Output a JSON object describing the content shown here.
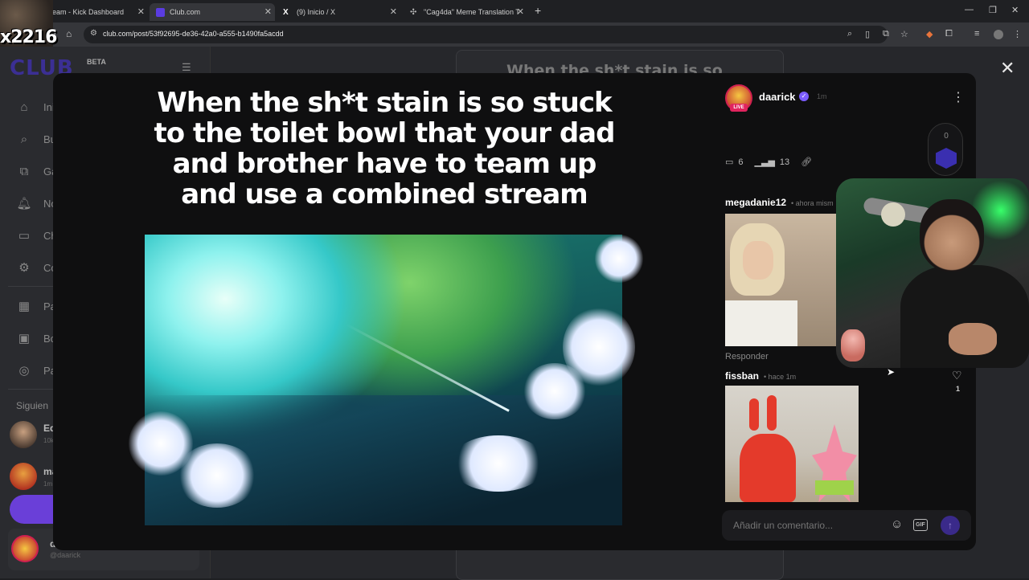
{
  "browser": {
    "tabs": [
      {
        "label": "ream - Kick Dashboard",
        "active": false,
        "favicon_color": "#53fc18"
      },
      {
        "label": "Club.com",
        "active": true,
        "favicon_color": "#5a3ce0"
      },
      {
        "label": "(9) Inicio / X",
        "active": false,
        "favicon_color": "#000000"
      },
      {
        "label": "\"Cag4da\" Meme Translation To",
        "active": false,
        "favicon_color": "#10a37f"
      }
    ],
    "url": "club.com/post/53f92695-de36-42a0-a555-b1490fa5acdd"
  },
  "overlay": {
    "combo": "x2216"
  },
  "sidebar": {
    "logo": "CLUB",
    "badge": "BETA",
    "items": [
      {
        "label": "Ini",
        "icon": "home-icon"
      },
      {
        "label": "Bu",
        "icon": "search-icon"
      },
      {
        "label": "Ga",
        "icon": "gallery-icon"
      },
      {
        "label": "No",
        "icon": "bell-icon"
      },
      {
        "label": "Ch",
        "icon": "chat-icon"
      },
      {
        "label": "Co",
        "icon": "gear-icon"
      },
      {
        "label": "Pa",
        "icon": "grid-icon"
      },
      {
        "label": "Bo",
        "icon": "bookmark-icon"
      },
      {
        "label": "Pa",
        "icon": "coin-icon"
      }
    ],
    "following_label": "Siguien",
    "following": [
      {
        "name": "Ed",
        "sub": "10k"
      },
      {
        "name": "ma",
        "sub": "1m"
      }
    ],
    "me": {
      "name": "da",
      "handle": "@daarick"
    }
  },
  "feed": {
    "title_partial": "When the sh*t stain is so"
  },
  "post": {
    "meme_caption": "When the sh*t stain is so stuck to the toilet bowl that your dad and brother have to team up and use a combined stream",
    "author": "daarick",
    "time": "1m",
    "live": "LIVE",
    "level": "0",
    "comments_count": "6",
    "views_count": "13"
  },
  "comments": [
    {
      "user": "megadanie12",
      "time": "• ahora mism",
      "reply_label": "Responder"
    },
    {
      "user": "fissban",
      "time": "• hace 1m",
      "likes": "1"
    }
  ],
  "composer": {
    "placeholder": "Añadir un comentario...",
    "gif_label": "GIF"
  }
}
